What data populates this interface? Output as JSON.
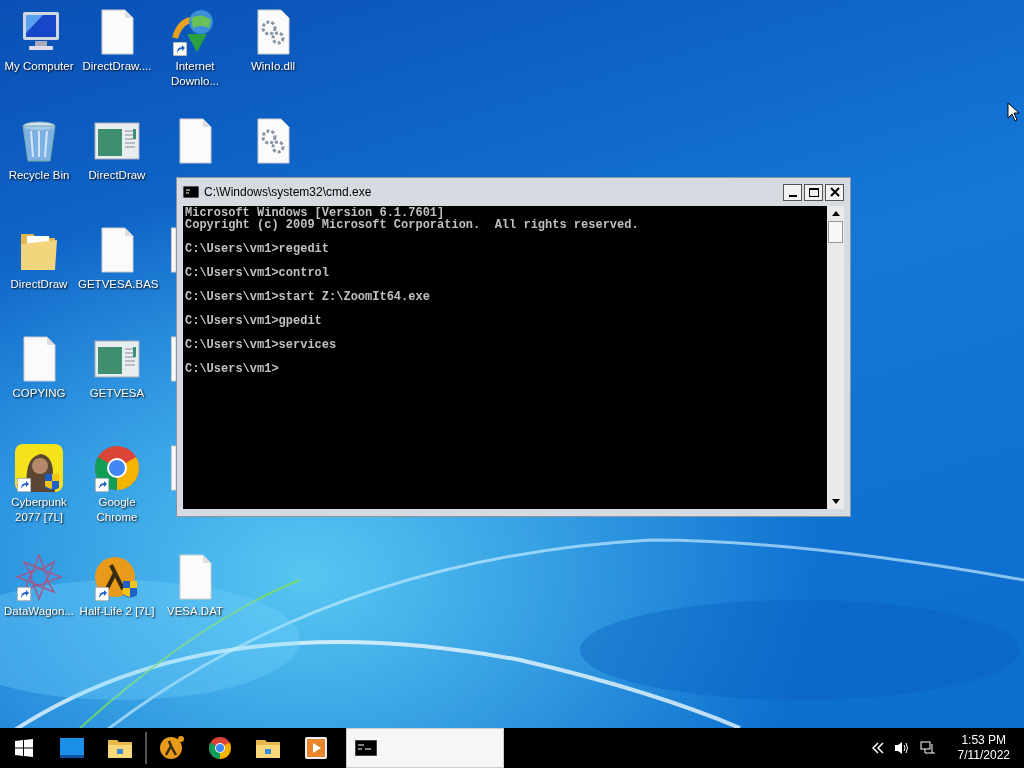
{
  "desktop_columns": [
    [
      {
        "kind": "computer",
        "label": "My Computer",
        "shortcut": false
      },
      {
        "kind": "recycle",
        "label": "Recycle Bin",
        "shortcut": false
      },
      {
        "kind": "folder",
        "label": "DirectDraw",
        "shortcut": false
      },
      {
        "kind": "file",
        "label": "COPYING",
        "shortcut": false
      },
      {
        "kind": "game",
        "label": "Cyberpunk 2077 [7L]",
        "shortcut": true
      },
      {
        "kind": "star",
        "label": "DataWagon...",
        "shortcut": true
      }
    ],
    [
      {
        "kind": "file",
        "label": "DirectDraw....",
        "shortcut": false
      },
      {
        "kind": "app",
        "label": "DirectDraw",
        "shortcut": false
      },
      {
        "kind": "file",
        "label": "GETVESA.BAS",
        "shortcut": false
      },
      {
        "kind": "app",
        "label": "GETVESA",
        "shortcut": false
      },
      {
        "kind": "chrome",
        "label": "Google Chrome",
        "shortcut": true
      },
      {
        "kind": "halflife",
        "label": "Half-Life 2 [7L]",
        "shortcut": true
      }
    ],
    [
      {
        "kind": "globe",
        "label": "Internet Downlo...",
        "shortcut": true
      },
      {
        "kind": "file",
        "shortcut": false
      },
      {
        "kind": "doc",
        "shortcut": false
      },
      {
        "kind": "doc",
        "shortcut": false
      },
      {
        "kind": "doc",
        "shortcut": false
      },
      {
        "kind": "file",
        "label": "VESA.DAT",
        "shortcut": false
      }
    ],
    [
      {
        "kind": "gearfile",
        "label": "WinIo.dll",
        "shortcut": false
      },
      {
        "kind": "gearfile",
        "shortcut": false
      }
    ]
  ],
  "cmd_window": {
    "title": "C:\\Windows\\system32\\cmd.exe",
    "header": [
      "Microsoft Windows [Version 6.1.7601]",
      "Copyright (c) 2009 Microsoft Corporation.  All rights reserved."
    ],
    "commands": [
      "C:\\Users\\vm1>regedit",
      "C:\\Users\\vm1>control",
      "C:\\Users\\vm1>start Z:\\ZoomIt64.exe",
      "C:\\Users\\vm1>gpedit",
      "C:\\Users\\vm1>services",
      "C:\\Users\\vm1>"
    ]
  },
  "taskbar": {
    "pinned": [
      {
        "kind": "start"
      },
      {
        "kind": "desktop"
      },
      {
        "kind": "folder"
      },
      {
        "kind": "separator"
      },
      {
        "kind": "halflife"
      },
      {
        "kind": "chrome"
      },
      {
        "kind": "folder"
      },
      {
        "kind": "media"
      }
    ],
    "open_windows": [
      {
        "kind": "console",
        "selected": true
      }
    ],
    "clock": {
      "time": "1:53 PM",
      "date": "7/11/2022"
    }
  }
}
